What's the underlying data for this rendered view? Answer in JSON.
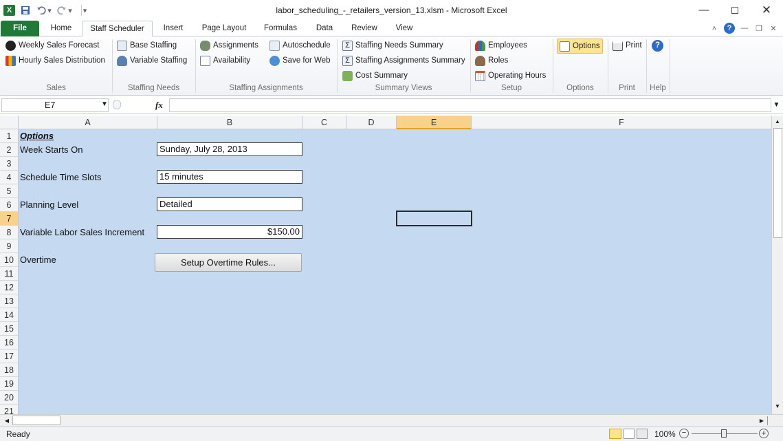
{
  "window": {
    "title": "labor_scheduling_-_retailers_version_13.xlsm  -  Microsoft Excel"
  },
  "tabs": [
    {
      "label": "File"
    },
    {
      "label": "Home"
    },
    {
      "label": "Staff Scheduler"
    },
    {
      "label": "Insert"
    },
    {
      "label": "Page Layout"
    },
    {
      "label": "Formulas"
    },
    {
      "label": "Data"
    },
    {
      "label": "Review"
    },
    {
      "label": "View"
    }
  ],
  "ribbon": {
    "sales": {
      "label": "Sales",
      "items": [
        "Weekly Sales Forecast",
        "Hourly Sales Distribution"
      ]
    },
    "staffing_needs": {
      "label": "Staffing Needs",
      "items": [
        "Base Staffing",
        "Variable Staffing"
      ]
    },
    "staffing_assignments": {
      "label": "Staffing Assignments",
      "items": [
        "Assignments",
        "Availability",
        "Autoschedule",
        "Save for Web"
      ]
    },
    "summary_views": {
      "label": "Summary Views",
      "items": [
        "Staffing Needs Summary",
        "Staffing Assignments Summary",
        "Cost Summary"
      ]
    },
    "setup": {
      "label": "Setup",
      "items": [
        "Employees",
        "Roles",
        "Operating Hours"
      ]
    },
    "options": {
      "label": "Options",
      "item": "Options"
    },
    "print": {
      "label": "Print",
      "item": "Print"
    },
    "help": {
      "label": "Help"
    }
  },
  "formula_bar": {
    "name_box": "E7",
    "fx": "fx",
    "value": ""
  },
  "columns": [
    "A",
    "B",
    "C",
    "D",
    "E",
    "F"
  ],
  "rows": [
    "1",
    "2",
    "3",
    "4",
    "5",
    "6",
    "7",
    "8",
    "9",
    "10",
    "11",
    "12",
    "13",
    "14",
    "15",
    "16",
    "17",
    "18",
    "19",
    "20",
    "21"
  ],
  "sheet": {
    "heading": "Options",
    "week_starts_label": "Week Starts On",
    "week_starts_value": "Sunday, July 28, 2013",
    "time_slots_label": "Schedule Time Slots",
    "time_slots_value": "15 minutes",
    "planning_level_label": "Planning Level",
    "planning_level_value": "Detailed",
    "variable_labor_label": "Variable Labor Sales Increment",
    "variable_labor_value": "$150.00",
    "overtime_label": "Overtime",
    "overtime_button": "Setup Overtime Rules..."
  },
  "status": {
    "ready": "Ready",
    "zoom": "100%"
  },
  "colors": {
    "sheet_bg": "#c5d9f0",
    "file_tab": "#1f7a37",
    "selection": "#f8d28a"
  }
}
